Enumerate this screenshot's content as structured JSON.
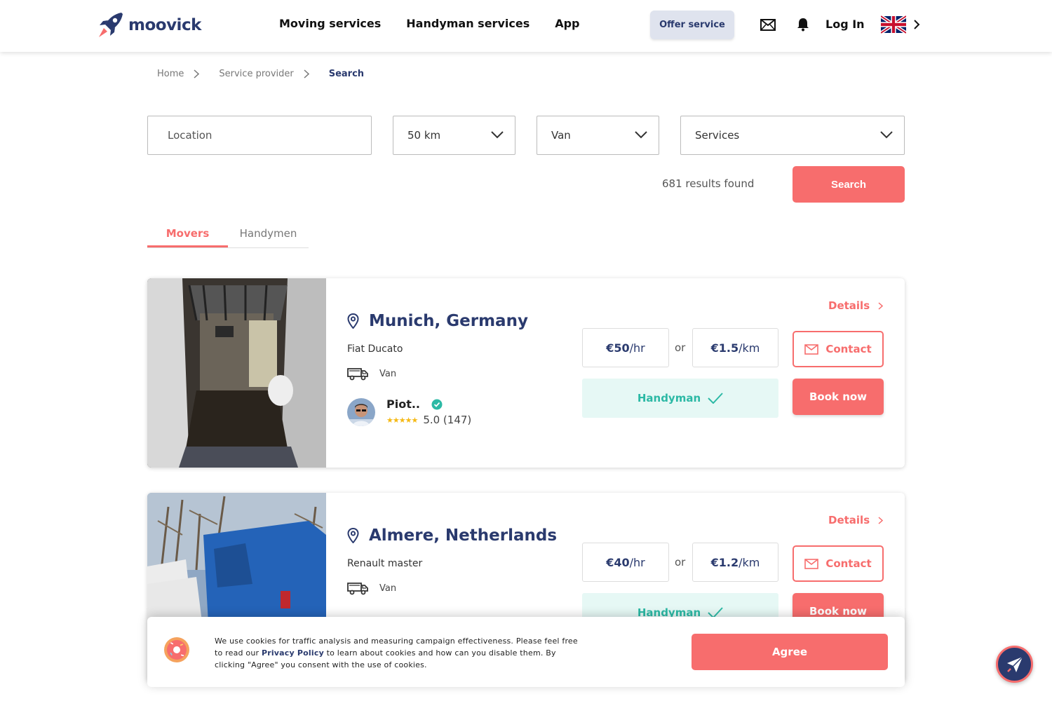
{
  "header": {
    "logo_text": "moovick",
    "nav": [
      "Moving services",
      "Handyman services",
      "App"
    ],
    "offer_service": "Offer service",
    "login": "Log In"
  },
  "breadcrumb": [
    "Home",
    "Service provider",
    "Search"
  ],
  "filters": {
    "location_placeholder": "Location",
    "radius": "50 km",
    "vehicle": "Van",
    "services": "Services"
  },
  "results_text": "681 results found",
  "search_label": "Search",
  "tabs": [
    "Movers",
    "Handymen"
  ],
  "listings": [
    {
      "city": "Munich, Germany",
      "model": "Fiat Ducato",
      "vehicle_type": "Van",
      "provider": "Piot..",
      "rating": "5.0 (147)",
      "details": "Details",
      "price_hour": "€50",
      "price_hour_unit": "/hr",
      "or": "or",
      "price_km": "€1.5",
      "price_km_unit": "/km",
      "handyman": "Handyman",
      "contact": "Contact",
      "book": "Book now"
    },
    {
      "city": "Almere, Netherlands",
      "model": "Renault master",
      "vehicle_type": "Van",
      "details": "Details",
      "price_hour": "€40",
      "price_hour_unit": "/hr",
      "or": "or",
      "price_km": "€1.2",
      "price_km_unit": "/km",
      "handyman": "Handyman",
      "contact": "Contact",
      "book": "Book now"
    }
  ],
  "cookie": {
    "text_before": "We use cookies for traffic analysis and measuring campaign effectiveness. Please feel free to read our ",
    "link": "Privacy Policy",
    "text_after": " to learn about cookies and how can you disable them. By clicking \"Agree\" you consent with the use of cookies.",
    "agree": "Agree"
  },
  "colors": {
    "accent": "#f76d6d",
    "brand": "#2a3a6e",
    "handyman_green": "#2cb9a5"
  }
}
